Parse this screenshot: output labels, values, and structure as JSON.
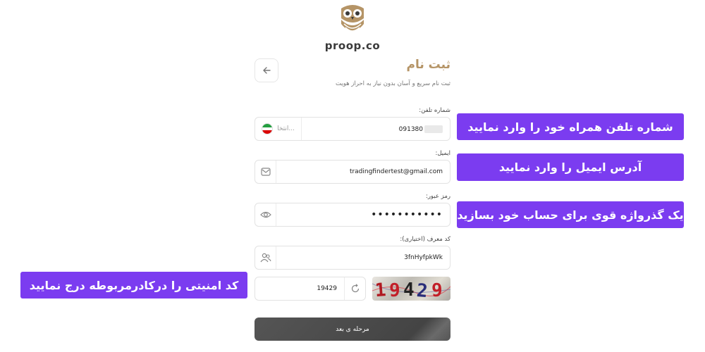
{
  "logo": {
    "text": "proop.co",
    "badge": ""
  },
  "header": {
    "title": "ثبت نام",
    "subtitle": "ثبت نام سریع و آسان بدون نیاز به احراز هویت",
    "back_icon": "arrow-left-icon"
  },
  "phone": {
    "label": "شماره تلفن:",
    "value": "091380",
    "country_placeholder": "انتخا...",
    "flag": {
      "top": "#239f40",
      "middle": "#ffffff",
      "bottom": "#da0000"
    }
  },
  "email": {
    "label": "ایمیل:",
    "value": "tradingfindertest@gmail.com",
    "icon": "mail-icon"
  },
  "password": {
    "label": "رمز عبور:",
    "value": "•••••••••••",
    "icon": "eye-icon"
  },
  "referral": {
    "label": "کد معرف (اختیاری):",
    "value": "3fnHyfpkWk",
    "icon": "users-icon"
  },
  "captcha": {
    "value": "19429",
    "image_text": "19429",
    "icon": "refresh-icon"
  },
  "submit": {
    "label": "مرحله ی بعد"
  },
  "callouts": {
    "phone": "شماره تلفن همراه خود را وارد نمایید",
    "email": "آدرس ایمیل را وارد نمایید",
    "password": "یک گذرواژه قوی برای حساب خود بسازید",
    "captcha": "کد امنیتی را درکادرمربوطه درج نمایید"
  },
  "colors": {
    "accent": "#b59466",
    "callout": "#7b3cf0",
    "button": "#4a4a4a"
  }
}
